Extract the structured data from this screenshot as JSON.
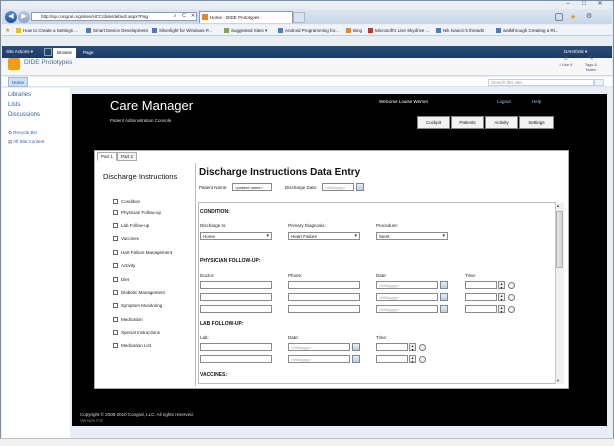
{
  "browser": {
    "url": "http://sp.congral.org/sites/HCC/dide/default.aspx?Pag",
    "tab_title": "Home - DIDE Prototypes",
    "favorites": [
      "How to Create a Settings ...",
      "Smart Device Development",
      "Silverlight for Windows P...",
      "Suggested Sites ▾",
      "Android Programming for...",
      "Bing",
      "Microsoft's Live Skydrive ...",
      "Nik Ivancic's threads",
      "walkthrough Creating a Rl..."
    ]
  },
  "sharepoint": {
    "site_actions": "Site Actions ▾",
    "ribbon_tabs": [
      "Browse",
      "Page"
    ],
    "user": "DAHS\\rsk ▾",
    "site_title": "DIDE Prototypes",
    "right_icons": [
      "I Like It",
      "Tags & Notes"
    ],
    "home": "Home",
    "search_placeholder": "Search this site...",
    "quick_launch": [
      "Libraries",
      "Lists",
      "Discussions"
    ],
    "quick_launch_small": [
      "Recycle Bin",
      "All Site Content"
    ]
  },
  "app": {
    "title": "Care Manager",
    "subtitle": "Patient Administration Console",
    "welcome": "Welcome Louise Werner",
    "logout": "Logout",
    "help": "Help",
    "nav": [
      "Cockpit",
      "Patients",
      "Activity",
      "Settings"
    ],
    "footer": "Copyright © 2008-2010 Congral, LLC. All rights reserved.",
    "version": "Version 0.9"
  },
  "form": {
    "part_tabs": [
      "Part 1",
      "Part 2"
    ],
    "left_heading": "Discharge Instructions",
    "checklist": [
      "Condition",
      "Physician Follow-up",
      "Lab Follow-up",
      "Vaccines",
      "Hart Failure Management",
      "Activity",
      "Diet",
      "Diabetic Management",
      "Symptom Monitoring",
      "Medication",
      "Special Instructions",
      "Medication List"
    ],
    "heading": "Discharge Instructions Data Entry",
    "patient_name_label": "Patient Name:",
    "patient_name_value": "<patient name>",
    "discharge_date_label": "Discharge Date:",
    "date_placeholder": "<M/d/yyyy>",
    "condition": {
      "header": "CONDITION:",
      "discharge_to_label": "Discharge to:",
      "discharge_to": "Home",
      "primary_dx_label": "Primary Diagnosis:",
      "primary_dx": "Heart Failure",
      "procedure_label": "Procedure:",
      "procedure": "Stent"
    },
    "physician": {
      "header": "PHYSICIAN FOLLOW-UP:",
      "doctor_label": "Doctor:",
      "phone_label": "Phone:",
      "date_label": "Date:",
      "time_label": "Time:"
    },
    "lab": {
      "header": "LAB FOLLOW-UP:",
      "lab_label": "Lab:",
      "date_label": "Date:",
      "time_label": "Time:"
    },
    "vaccines": {
      "header": "VACCINES:"
    }
  }
}
